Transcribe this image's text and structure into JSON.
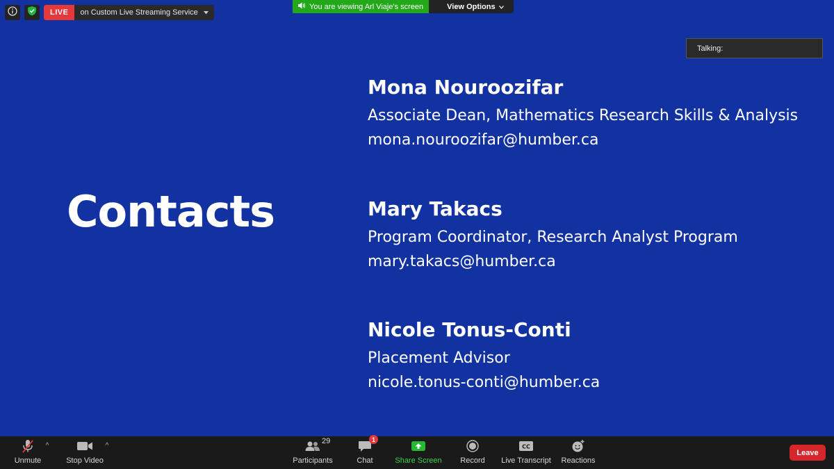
{
  "top_bar": {
    "live_label": "LIVE",
    "live_service": "on Custom Live Streaming Service",
    "viewing_text": "You are viewing Arl Viaje's screen",
    "view_options_label": "View Options"
  },
  "talking_panel": {
    "label": "Talking:"
  },
  "slide": {
    "title": "Contacts",
    "contacts": [
      {
        "name": "Mona Nouroozifar",
        "role": "Associate Dean, Mathematics Research Skills & Analysis",
        "email": "mona.nouroozifar@humber.ca"
      },
      {
        "name": "Mary Takacs",
        "role": "Program Coordinator, Research Analyst Program",
        "email": "mary.takacs@humber.ca"
      },
      {
        "name": "Nicole Tonus-Conti",
        "role": "Placement Advisor",
        "email": "nicole.tonus-conti@humber.ca"
      }
    ]
  },
  "toolbar": {
    "unmute": "Unmute",
    "stop_video": "Stop Video",
    "participants": "Participants",
    "participants_count": "29",
    "chat": "Chat",
    "chat_badge": "1",
    "share_screen": "Share Screen",
    "record": "Record",
    "live_transcript": "Live Transcript",
    "reactions": "Reactions",
    "leave": "Leave"
  },
  "colors": {
    "slide_background": "#1232a2",
    "live_red": "#e5383b",
    "share_green": "#3ad34a",
    "banner_green": "#23a81a",
    "leave_red": "#d5262b"
  }
}
